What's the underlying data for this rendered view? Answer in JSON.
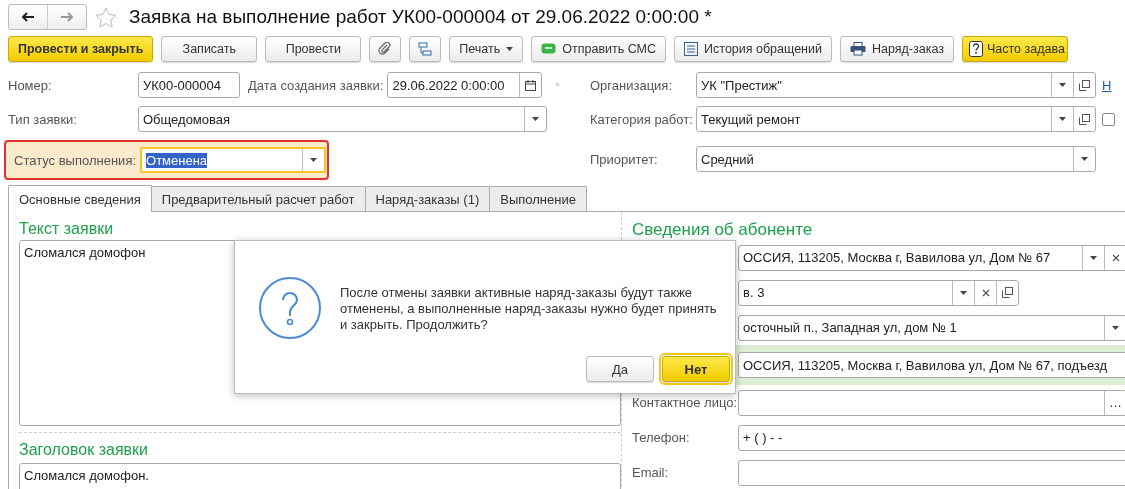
{
  "window": {
    "title": "Заявка на выполнение работ УК00-000004 от 29.06.2022 0:00:00 *"
  },
  "toolbar": [
    {
      "label": "Провести и закрыть",
      "kind": "primary"
    },
    {
      "label": "Записать",
      "kind": "plain"
    },
    {
      "label": "Провести",
      "kind": "plain"
    },
    {
      "kind": "clip"
    },
    {
      "kind": "structure"
    },
    {
      "label": "Печать",
      "kind": "menu"
    },
    {
      "label": "Отправить СМС",
      "kind": "sms"
    },
    {
      "label": "История обращений",
      "kind": "history"
    },
    {
      "label": "Наряд-заказ",
      "kind": "print"
    },
    {
      "label": "Часто задава",
      "kind": "help"
    }
  ],
  "header": {
    "number": {
      "label": "Номер:",
      "value": "УК00-000004"
    },
    "created": {
      "label": "Дата создания заявки:",
      "value": "29.06.2022  0:00:00"
    },
    "type": {
      "label": "Тип заявки:",
      "value": "Общедомовая"
    },
    "status": {
      "label": "Статус выполнения:",
      "value": "Отменена"
    },
    "organization": {
      "label": "Организация:",
      "value": "УК \"Престиж\""
    },
    "link": "Н",
    "category": {
      "label": "Категория работ:",
      "value": "Текущий ремонт"
    },
    "category_checkbox": {
      "checked": false
    },
    "priority": {
      "label": "Приоритет:",
      "value": "Средний"
    }
  },
  "tabs": [
    {
      "label": "Основные сведения",
      "selected": true
    },
    {
      "label": "Предварительный расчет работ",
      "selected": false
    },
    {
      "label": "Наряд-заказы (1)",
      "selected": false
    },
    {
      "label": "Выполнение",
      "selected": false
    }
  ],
  "request_text": {
    "heading": "Текст заявки",
    "value": "Сломался домофон"
  },
  "request_title": {
    "heading": "Заголовок заявки",
    "value": "Сломался домофон."
  },
  "subscriber": {
    "heading": "Сведения об абоненте",
    "fields": [
      {
        "kind": "select-clear",
        "value": "ОССИЯ, 113205, Москва г, Вавилова ул, Дом № 67"
      },
      {
        "kind": "select-clear-open",
        "value": "в. 3"
      },
      {
        "kind": "select",
        "value": "осточный п., Западная ул, дом № 1"
      },
      {
        "kind": "highlighted",
        "value": "ОССИЯ, 113205, Москва г, Вавилова ул, Дом № 67, подъезд"
      },
      {
        "kind": "choose",
        "label": "Контактное лицо:",
        "button": "…"
      },
      {
        "kind": "text",
        "label": "Телефон:",
        "value": "+ (   )   -  -"
      },
      {
        "kind": "text",
        "label": "Email:"
      }
    ]
  },
  "dialog": {
    "message": "После отмены заявки активные наряд-заказы будут также отменены, а выполненные наряд-заказы нужно будет принять и закрыть. Продолжить?",
    "buttons": [
      {
        "label": "Да",
        "selected": false
      },
      {
        "label": "Нет",
        "selected": true
      }
    ]
  }
}
